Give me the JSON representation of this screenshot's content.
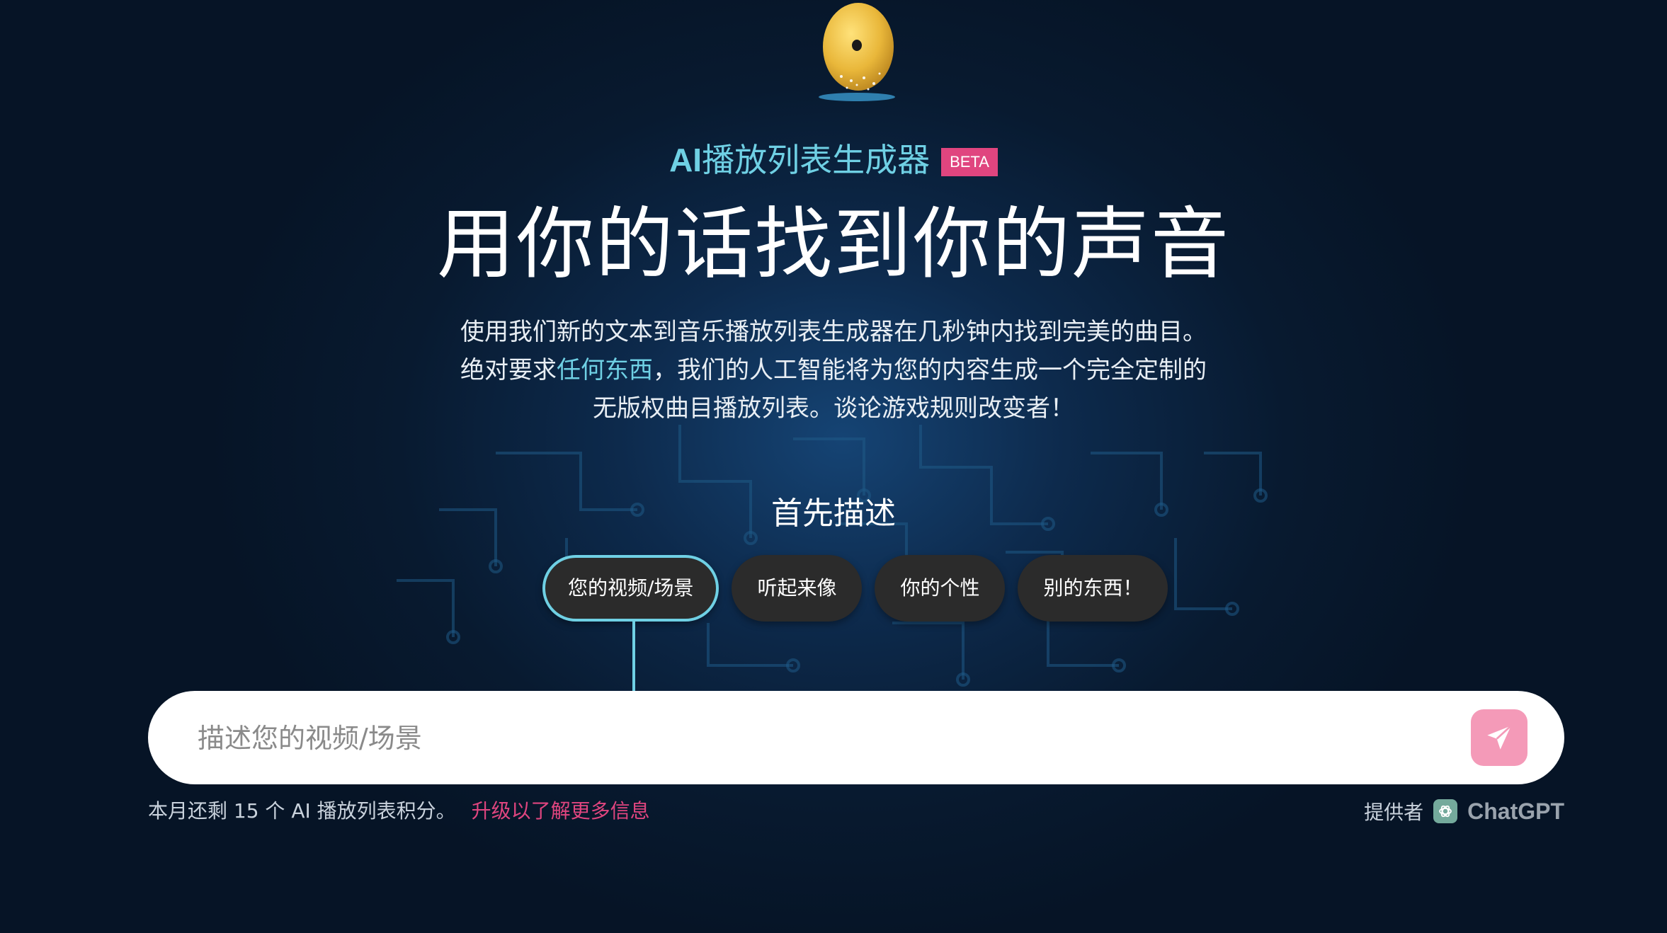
{
  "brand": {
    "prefix": "AI",
    "name": "播放列表生成器",
    "badge": "BETA"
  },
  "hero": {
    "headline": "用你的话找到你的声音",
    "desc_line1": "使用我们新的文本到音乐播放列表生成器在几秒钟内找到完美的曲目。",
    "desc_line2_pre": "绝对要求",
    "desc_line2_link": "任何东西",
    "desc_line2_post": "，我们的人工智能将为您的内容生成一个完全定制的",
    "desc_line3": "无版权曲目播放列表。谈论游戏规则改变者！"
  },
  "step": {
    "title": "首先描述",
    "options": [
      "您的视频/场景",
      "听起来像",
      "你的个性",
      "别的东西！"
    ],
    "active_index": 0
  },
  "search": {
    "placeholder": "描述您的视频/场景",
    "value": ""
  },
  "footer": {
    "credits_text": "本月还剩 15 个 AI 播放列表积分。",
    "upgrade_link": "升级以了解更多信息",
    "provider_label": "提供者",
    "provider_name": "ChatGPT"
  },
  "icons": {
    "logo": "golden-disc-logo",
    "send": "paper-plane-icon",
    "provider": "openai-icon"
  },
  "colors": {
    "accent": "#6fd0e4",
    "brand_pink": "#e0457f",
    "send_button": "#f49ab8",
    "pill_bg": "#2b2b2b"
  }
}
